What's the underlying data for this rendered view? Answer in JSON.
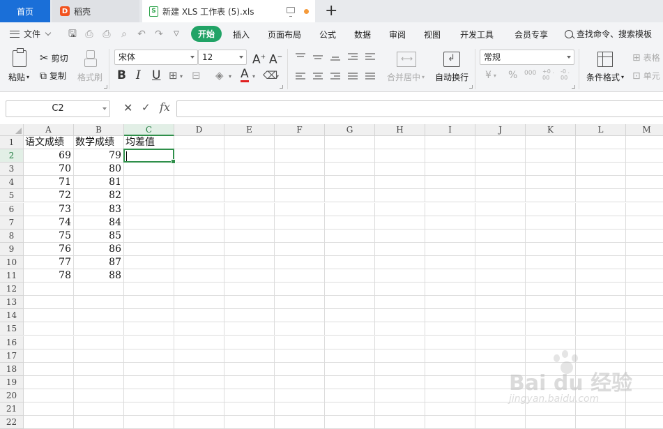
{
  "tabs": {
    "home": "首页",
    "daoke": "稻壳",
    "file": "新建 XLS 工作表 (5).xls",
    "add_tab": "+"
  },
  "menu": {
    "file": "文件",
    "tabs": [
      "开始",
      "插入",
      "页面布局",
      "公式",
      "数据",
      "审阅",
      "视图",
      "开发工具",
      "会员专享"
    ],
    "active_tab": "开始",
    "search": "查找命令、搜索模板"
  },
  "ribbon": {
    "paste": "粘贴",
    "cut": "剪切",
    "copy": "复制",
    "format_painter": "格式刷",
    "font_name": "宋体",
    "font_size": "12",
    "increase_font": "A",
    "decrease_font": "A",
    "bold": "B",
    "italic": "I",
    "underline": "U",
    "font_color_letter": "A",
    "merge_center": "合并居中",
    "wrap_text": "自动换行",
    "number_format": "常规",
    "currency": "¥",
    "percent": "%",
    "thousands": "000",
    "inc_decimal": "+0 .00",
    "dec_decimal": "-0 .00",
    "conditional_format": "条件格式",
    "table_style": "表格",
    "cell_style": "单元"
  },
  "colors": {
    "accent_green": "#21a366",
    "home_blue": "#1a6fd8",
    "selection_green": "#2f8f4a",
    "unsaved_dot": "#f59a3a"
  },
  "formula_bar": {
    "name_box": "C2",
    "cancel": "✕",
    "confirm": "✓",
    "fx": "fx",
    "content": ""
  },
  "sheet": {
    "columns": [
      "A",
      "B",
      "C",
      "D",
      "E",
      "F",
      "G",
      "H",
      "I",
      "J",
      "K",
      "L",
      "M"
    ],
    "rows": [
      "1",
      "2",
      "3",
      "4",
      "5",
      "6",
      "7",
      "8",
      "9",
      "10",
      "11",
      "12",
      "13",
      "14",
      "15",
      "16",
      "17",
      "18",
      "19",
      "20",
      "21",
      "22"
    ],
    "active_cell": "C2",
    "headers": [
      "语文成绩",
      "数学成绩",
      "均差值"
    ],
    "data": [
      [
        "69",
        "79"
      ],
      [
        "70",
        "80"
      ],
      [
        "71",
        "81"
      ],
      [
        "72",
        "82"
      ],
      [
        "73",
        "83"
      ],
      [
        "74",
        "84"
      ],
      [
        "75",
        "85"
      ],
      [
        "76",
        "86"
      ],
      [
        "77",
        "87"
      ],
      [
        "78",
        "88"
      ]
    ]
  },
  "watermark": {
    "main": "Bai du 经验",
    "sub": "jingyan.baidu.com"
  }
}
